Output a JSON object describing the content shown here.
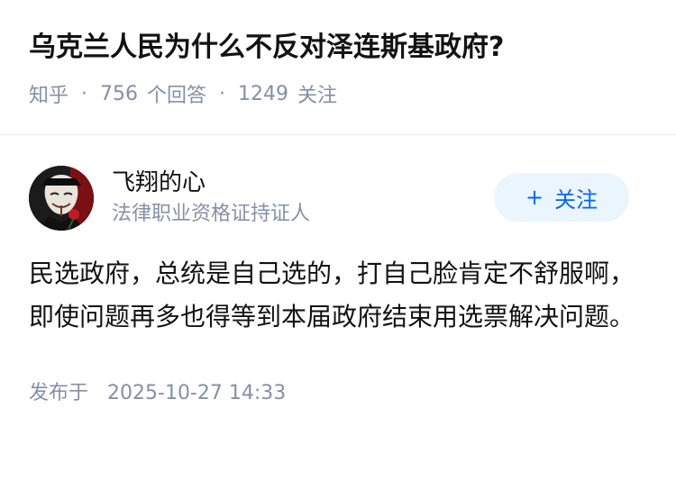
{
  "question": {
    "title": "乌克兰人民为什么不反对泽连斯基政府?",
    "source": "知乎",
    "separator": "·",
    "answer_count": "756",
    "answer_label": "个回答",
    "follow_count": "1249",
    "follow_label": "关注"
  },
  "answer": {
    "author_name": "飞翔的心",
    "author_bio": "法律职业资格证持证人",
    "follow_button": {
      "icon": "plus-icon",
      "plus": "+",
      "label": "关注"
    },
    "content": "民选政府，总统是自己选的，打自己脸肯定不舒服啊，即使问题再多也得等到本届政府结束用选票解决问题。",
    "published_label": "发布于",
    "published_time": "2025-10-27 14:33"
  },
  "colors": {
    "title": "#121212",
    "meta": "#8590a6",
    "accent": "#0066ff",
    "button_bg": "#ebf5fd"
  }
}
